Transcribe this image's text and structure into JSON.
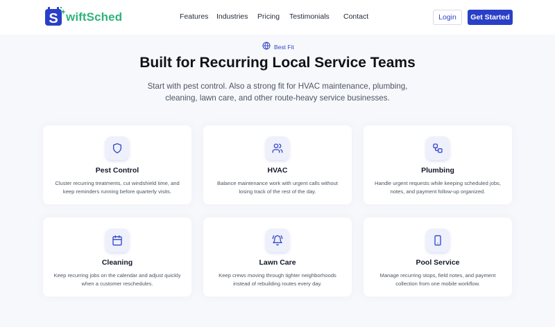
{
  "brand": {
    "name": "wiftSched",
    "accent_color": "#2a3fc7",
    "brand_green": "#2fb37a"
  },
  "nav": {
    "links": [
      {
        "label": "Features"
      },
      {
        "label": "Industries"
      },
      {
        "label": "Pricing"
      },
      {
        "label": "Testimonials"
      },
      {
        "label": "Contact"
      }
    ],
    "login_label": "Login",
    "cta_label": "Get Started"
  },
  "hero": {
    "badge_icon": "globe-icon",
    "badge": "Best Fit",
    "title": "Built for Recurring Local Service Teams",
    "subtitle": "Start with pest control. Also a strong fit for HVAC maintenance, plumbing, cleaning, lawn care, and other route-heavy service businesses."
  },
  "industries": [
    {
      "icon": "shield-icon",
      "title": "Pest Control",
      "description": "Cluster recurring treatments, cut windshield time, and keep reminders running before quarterly visits."
    },
    {
      "icon": "users-icon",
      "title": "HVAC",
      "description": "Balance maintenance work with urgent calls without losing track of the rest of the day."
    },
    {
      "icon": "workflow-icon",
      "title": "Plumbing",
      "description": "Handle urgent requests while keeping scheduled jobs, notes, and payment follow-up organized."
    },
    {
      "icon": "calendar-icon",
      "title": "Cleaning",
      "description": "Keep recurring jobs on the calendar and adjust quickly when a customer reschedules."
    },
    {
      "icon": "bell-icon",
      "title": "Lawn Care",
      "description": "Keep crews moving through tighter neighborhoods instead of rebuilding routes every day."
    },
    {
      "icon": "smartphone-icon",
      "title": "Pool Service",
      "description": "Manage recurring stops, field notes, and payment collection from one mobile workflow."
    }
  ]
}
